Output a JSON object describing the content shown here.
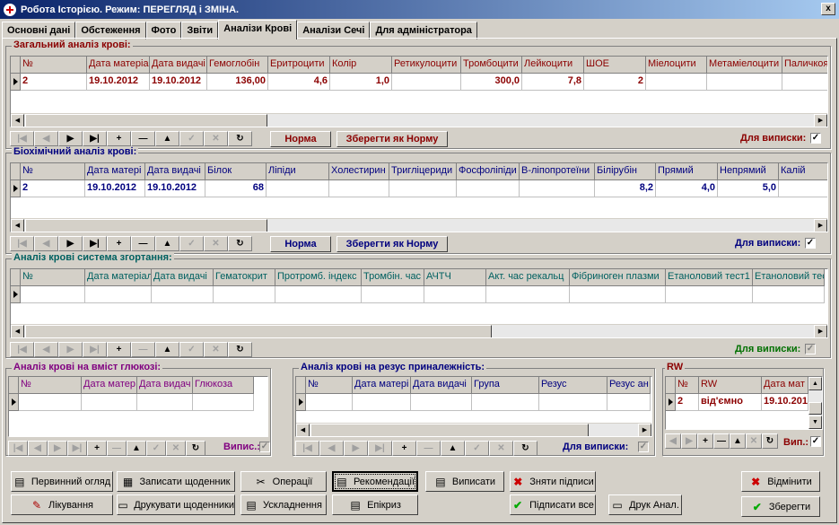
{
  "window": {
    "title": "Робота Історією. Режим: ПЕРЕГЛЯД і ЗМІНА.",
    "close": "x"
  },
  "tabs": [
    "Основні дані",
    "Обстеження",
    "Фото",
    "Звіти",
    "Аналізи Крові",
    "Аналізи Сечі",
    "Для адміністратора"
  ],
  "active_tab": 4,
  "nav": {
    "first": "|◀",
    "prev": "◀",
    "next": "▶",
    "last": "▶|",
    "insert": "+",
    "delete": "—",
    "edit": "▲",
    "post": "✓",
    "cancel": "✕",
    "refresh": "↻"
  },
  "general": {
    "title": "Загальний аналіз крові:",
    "headers": [
      "№",
      "Дата матеріа",
      "Дата видачі",
      "Гемоглобін",
      "Еритроцити",
      "Колір",
      "Ретикулоцити",
      "Тромбоцити",
      "Лейкоцити",
      "ШОЕ",
      "Міелоцити",
      "Метаміелоцити",
      "Паличкоя"
    ],
    "row": [
      "2",
      "19.10.2012",
      "19.10.2012",
      "136,00",
      "4,6",
      "1,0",
      "",
      "300,0",
      "7,8",
      "2",
      "",
      "",
      ""
    ],
    "norm_btn": "Норма",
    "save_norm_btn": "Зберегти як Норму",
    "extract_label": "Для виписки:",
    "extract_checked": "✓"
  },
  "biochem": {
    "title": "Біохімічний аналіз крові:",
    "headers": [
      "№",
      "Дата матері",
      "Дата видачі",
      "Білок",
      "Ліпіди",
      "Холестирин",
      "Тригліцериди",
      "Фосфоліпіди",
      "В-ліпопротеїни",
      "Білірубін",
      "Прямий",
      "Непрямий",
      "Калій"
    ],
    "row": [
      "2",
      "19.10.2012",
      "19.10.2012",
      "68",
      "",
      "",
      "",
      "",
      "",
      "8,2",
      "4,0",
      "5,0",
      ""
    ],
    "norm_btn": "Норма",
    "save_norm_btn": "Зберегти як Норму",
    "extract_label": "Для виписки:",
    "extract_checked": "✓"
  },
  "coag": {
    "title": "Аналіз крові система згортання:",
    "headers": [
      "№",
      "Дата матеріал",
      "Дата видачі",
      "Гематокрит",
      "Протромб. індекс",
      "Тромбін. час",
      "АЧТЧ",
      "Акт. час рекальц",
      "Фібриноген плазми",
      "Етаноловий тест1",
      "Етаноловий тест"
    ],
    "extract_label": "Для виписки:",
    "extract_checked": "✓"
  },
  "glucose": {
    "title": "Аналіз крові на вміст глюкозі:",
    "headers": [
      "№",
      "Дата матер",
      "Дата видач",
      "Глюкоза"
    ],
    "extract_label": "Випис.:",
    "extract_checked": "✓"
  },
  "rhesus": {
    "title": "Аналіз крові на резус приналежність:",
    "headers": [
      "№",
      "Дата матері",
      "Дата видачі",
      "Група",
      "Резус",
      "Резус ан"
    ],
    "extract_label": "Для виписки:",
    "extract_checked": "✓"
  },
  "rw": {
    "title": "RW",
    "headers": [
      "№",
      "RW",
      "Дата мат"
    ],
    "row": [
      "2",
      "від'ємно",
      "19.10.201"
    ],
    "extract_label": "Вип.:",
    "extract_checked": "✓"
  },
  "buttons": {
    "primary_exam": "Первинний огляд",
    "write_diary": "Записати щоденник",
    "operations": "Операції",
    "recommendations": "Рекомендації",
    "discharge": "Виписати",
    "remove_signatures": "Зняти підписи",
    "cancel": "Відмінити",
    "treatment": "Лікування",
    "print_diaries": "Друкувати щоденники",
    "complications": "Ускладнення",
    "epicrisis": "Епікриз",
    "sign_all": "Підписати все",
    "print_anal": "Друк Анал.",
    "save": "Зберегти"
  }
}
